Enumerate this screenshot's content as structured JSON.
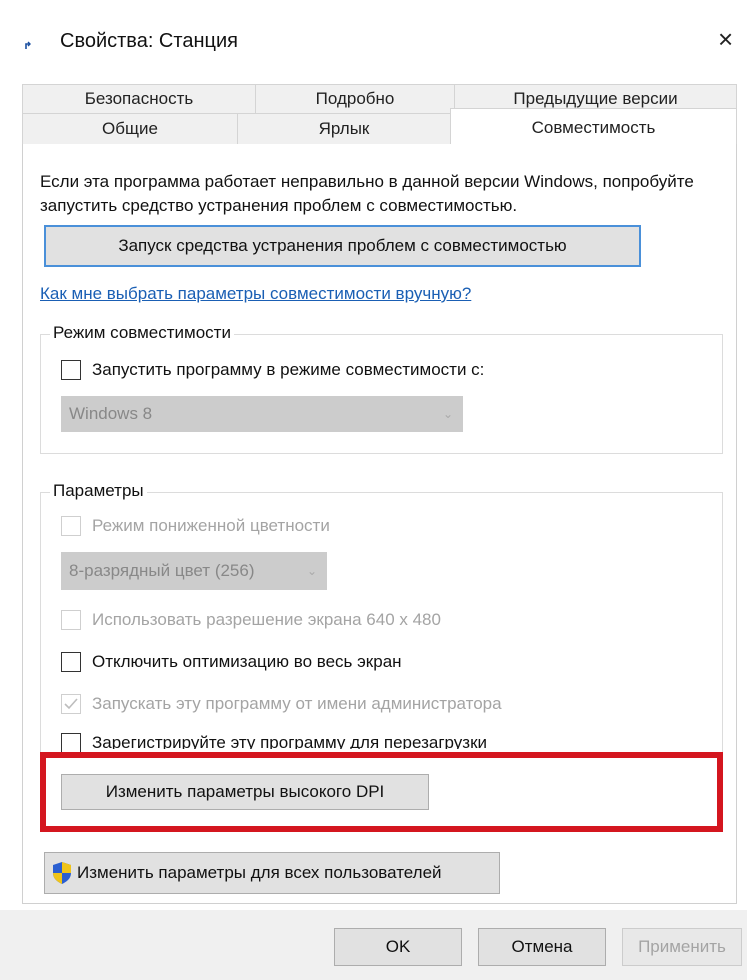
{
  "window": {
    "title": "Свойства: Станция",
    "close_glyph": "×",
    "icon": "shortcut-icon"
  },
  "tabs": {
    "row1": [
      "Безопасность",
      "Подробно",
      "Предыдущие версии"
    ],
    "row2": [
      "Общие",
      "Ярлык",
      "Совместимость"
    ],
    "active": "Совместимость"
  },
  "compat": {
    "intro": "Если эта программа работает неправильно в данной версии Windows, попробуйте запустить средство устранения проблем с совместимостью.",
    "troubleshoot_button": "Запуск средства устранения проблем с совместимостью",
    "manual_link": "Как мне выбрать параметры совместимости вручную?",
    "mode_group": {
      "legend": "Режим совместимости",
      "checkbox_label": "Запустить программу в режиме совместимости с:",
      "checked": false,
      "select_value": "Windows 8"
    },
    "params_group": {
      "legend": "Параметры",
      "reduced_color_label": "Режим пониженной цветности",
      "color_select_value": "8-разрядный цвет (256)",
      "resolution_label": "Использовать разрешение экрана 640 x 480",
      "fullscreen_opt_label": "Отключить оптимизацию во весь экран",
      "run_as_admin_label": "Запускать эту программу от имени администратора",
      "register_restart_label": "Зарегистрируйте эту программу для перезагрузки",
      "high_dpi_button": "Изменить параметры высокого DPI"
    },
    "all_users_button": "Изменить параметры для всех пользователей"
  },
  "footer": {
    "ok": "OK",
    "cancel": "Отмена",
    "apply": "Применить"
  },
  "colors": {
    "highlight": "#d4161f",
    "link": "#1a5fb4",
    "primary_border": "#4a90d9"
  }
}
